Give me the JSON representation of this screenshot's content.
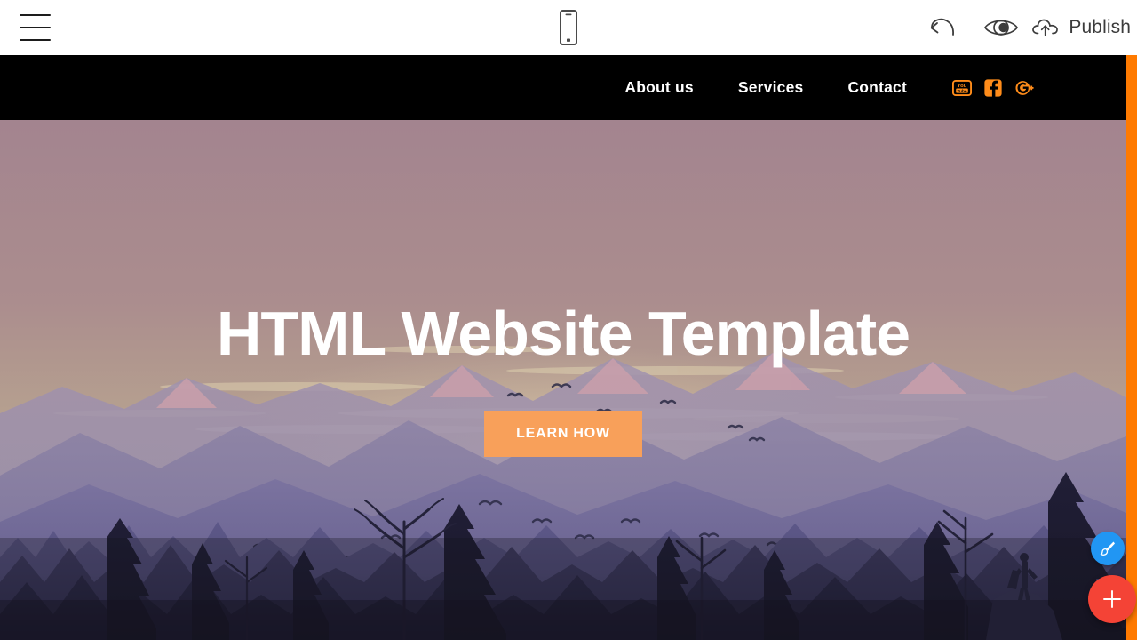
{
  "toolbar": {
    "menu_icon": "hamburger-menu-icon",
    "device_icon": "mobile-preview-icon",
    "undo_icon": "undo-arrow-icon",
    "preview_icon": "eye-preview-icon",
    "publish_icon": "cloud-upload-icon",
    "publish_label": "Publish",
    "background": "#ffffff"
  },
  "sitenav": {
    "background": "#000000",
    "links": [
      {
        "label": "About us"
      },
      {
        "label": "Services"
      },
      {
        "label": "Contact"
      }
    ],
    "socials": [
      {
        "name": "youtube-icon",
        "color": "#ff8c1a"
      },
      {
        "name": "facebook-icon",
        "color": "#ff8c1a"
      },
      {
        "name": "google-plus-icon",
        "color": "#ff8c1a"
      }
    ]
  },
  "hero": {
    "title": "HTML Website Template",
    "button_label": "LEARN HOW",
    "button_color": "#f8a05a",
    "title_color": "#ffffff",
    "sky_top_color": "#a3848f",
    "sky_bottom_color": "#b9a891",
    "mountain_color": "#8d86a8",
    "forest_color": "#2b2b49"
  },
  "scrollbar": {
    "color": "#ff7a00"
  },
  "fabs": [
    {
      "name": "style-paintbrush-button",
      "icon": "paintbrush-icon",
      "color": "#2196f3"
    },
    {
      "name": "add-block-button",
      "icon": "plus-icon",
      "color": "#f44336"
    }
  ]
}
